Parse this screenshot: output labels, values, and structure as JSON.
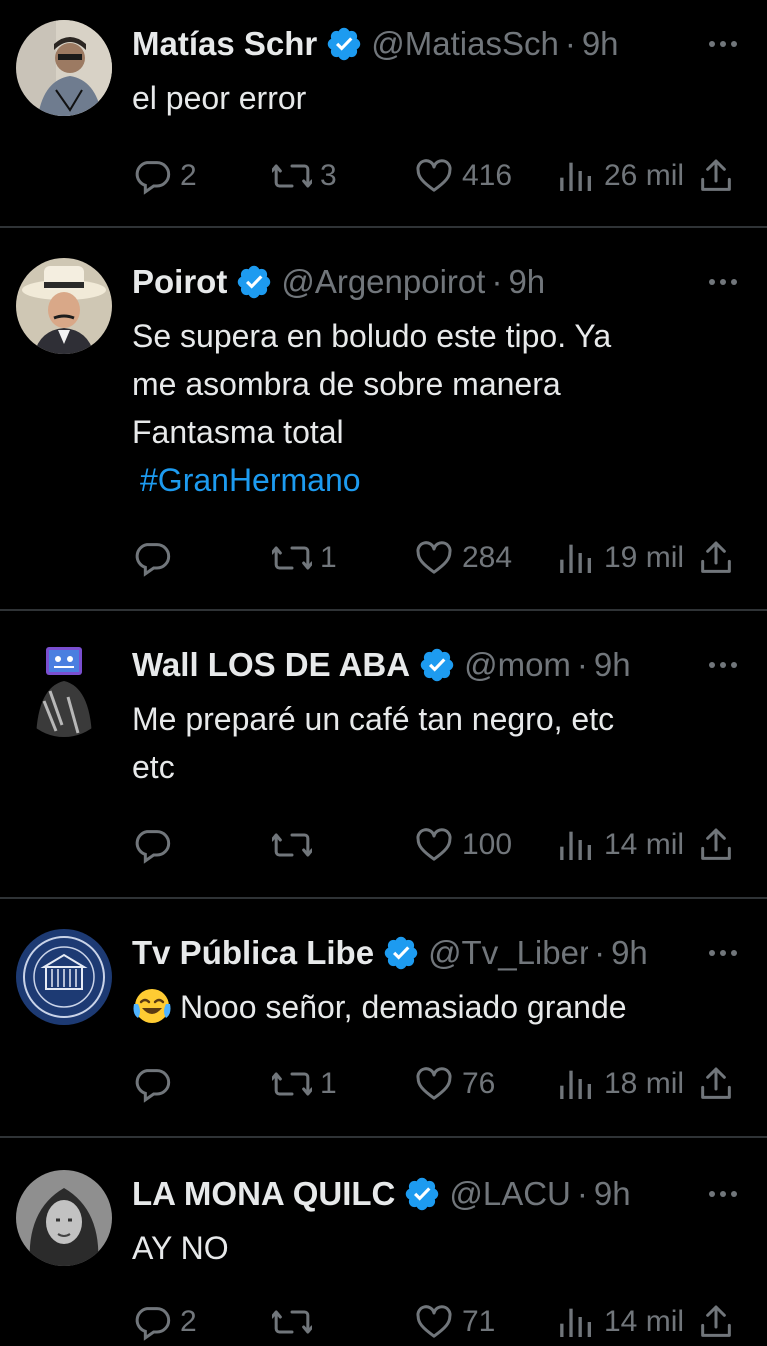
{
  "tweets": [
    {
      "name": "Matías Schr",
      "handle": "@MatiasSch",
      "time": "9h",
      "text_lines": [
        "el peor error"
      ],
      "hashtag": "",
      "emoji": "",
      "replies": "2",
      "retweets": "3",
      "likes": "416",
      "views": "26 mil"
    },
    {
      "name": "Poirot",
      "handle": "@Argenpoirot",
      "time": "9h",
      "text_lines": [
        "Se supera en boludo este tipo. Ya",
        "me asombra de sobre manera",
        "Fantasma total"
      ],
      "hashtag": "#GranHermano",
      "emoji": "",
      "replies": "",
      "retweets": "1",
      "likes": "284",
      "views": "19 mil"
    },
    {
      "name": "Wall LOS DE ABA",
      "handle": "@mom",
      "time": "9h",
      "text_lines": [
        "Me preparé un café tan negro, etc",
        "etc"
      ],
      "hashtag": "",
      "emoji": "",
      "replies": "",
      "retweets": "",
      "likes": "100",
      "views": "14 mil"
    },
    {
      "name": "Tv Pública Libe",
      "handle": "@Tv_Liber",
      "time": "9h",
      "text_lines": [
        "Nooo señor, demasiado grande"
      ],
      "hashtag": "",
      "emoji": "face-with-tears-of-joy",
      "replies": "",
      "retweets": "1",
      "likes": "76",
      "views": "18 mil"
    },
    {
      "name": "LA MONA QUILC",
      "handle": "@LACU",
      "time": "9h",
      "text_lines": [
        "AY NO"
      ],
      "hashtag": "",
      "emoji": "",
      "replies": "2",
      "retweets": "",
      "likes": "71",
      "views": "14 mil"
    }
  ],
  "colors": {
    "background": "#000000",
    "text": "#e7e9ea",
    "muted": "#71767b",
    "accent": "#1d9bf0",
    "divider": "#2f3336"
  },
  "icons": [
    "reply-icon",
    "retweet-icon",
    "like-icon",
    "views-icon",
    "share-icon",
    "verified-badge-icon",
    "more-icon"
  ]
}
